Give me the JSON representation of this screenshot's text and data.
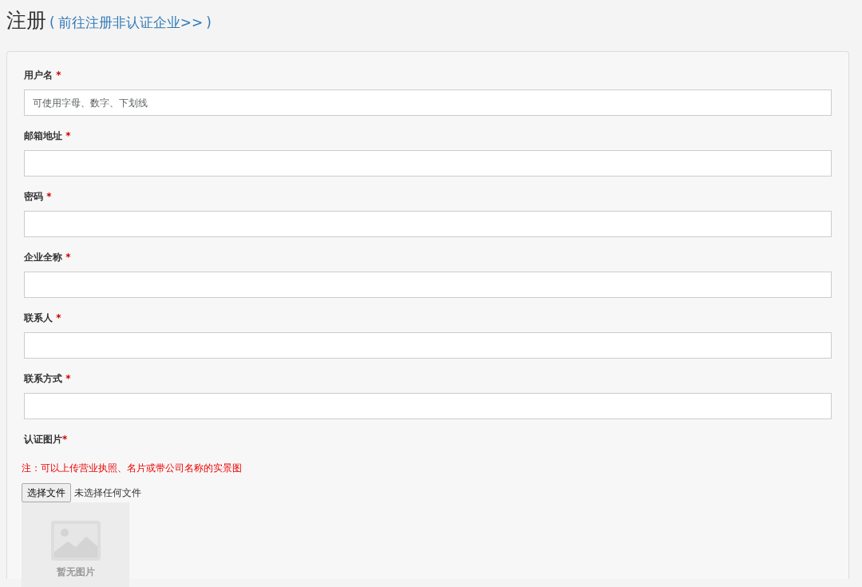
{
  "title": "注册",
  "link": {
    "open": "(",
    "text": "前往注册非认证企业>>",
    "close": ")"
  },
  "fields": [
    {
      "label": "用户名",
      "required": "*",
      "placeholder": "可使用字母、数字、下划线"
    },
    {
      "label": "邮箱地址",
      "required": "*"
    },
    {
      "label": "密码",
      "required": "*"
    },
    {
      "label": "企业全称",
      "required": "*"
    },
    {
      "label": "联系人",
      "required": "*"
    },
    {
      "label": "联系方式",
      "required": "*"
    }
  ],
  "upload": {
    "label": "认证图片",
    "required": "*",
    "note": "注：可以上传营业执照、名片或带公司名称的实景图",
    "button": "选择文件",
    "status": "未选择任何文件",
    "preview_text": "暂无图片"
  }
}
